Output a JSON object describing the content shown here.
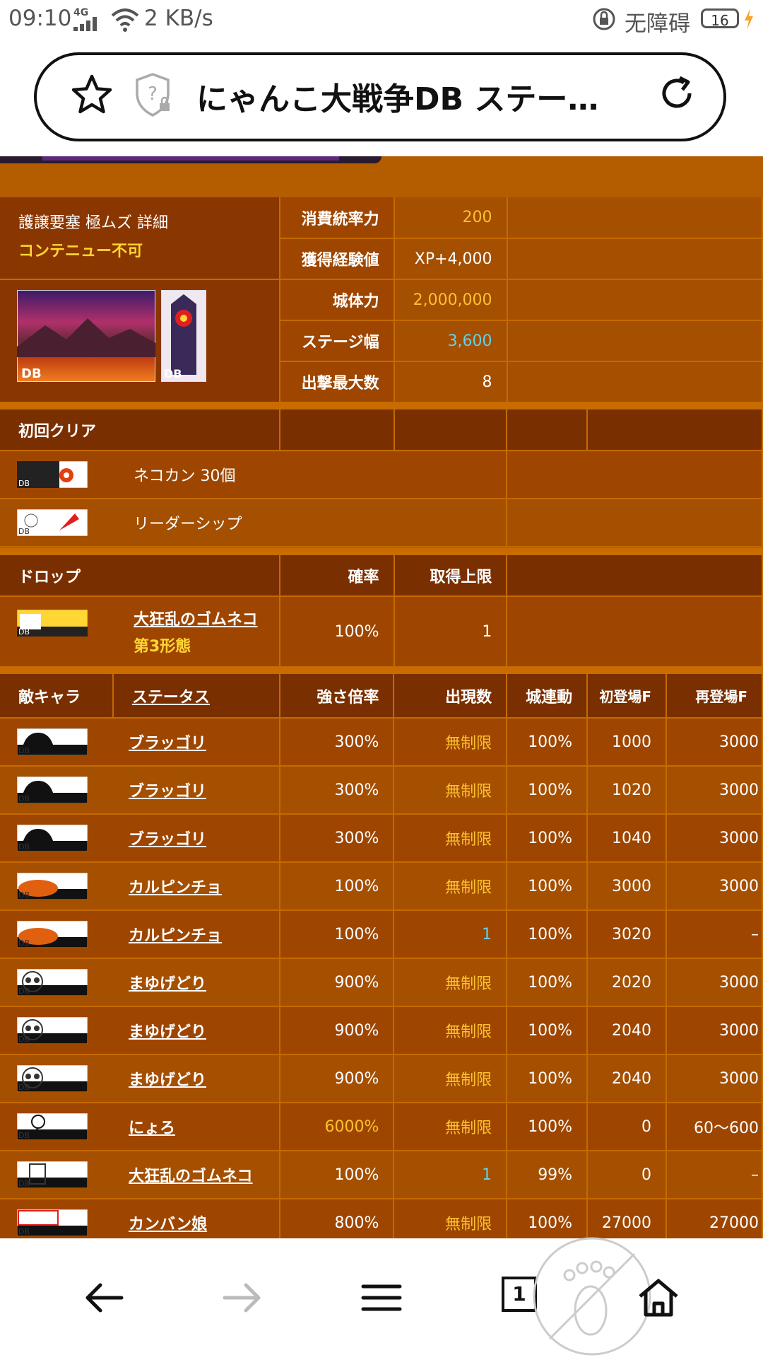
{
  "status_bar": {
    "time": "09:10",
    "network": "4G",
    "speed": "2 KB/s",
    "accessibility": "无障碍",
    "battery": "16"
  },
  "browser": {
    "page_title": "にゃんこ大戦争DB ステー…"
  },
  "stage": {
    "name": "護譲要塞 極ムズ 詳細",
    "note": "コンテニュー不可",
    "thumb_badge": "DB",
    "stats": [
      {
        "label": "消費統率力",
        "value": "200",
        "color": "gold"
      },
      {
        "label": "獲得経験値",
        "value": "XP+4,000",
        "color": "white"
      },
      {
        "label": "城体力",
        "value": "2,000,000",
        "color": "gold"
      },
      {
        "label": "ステージ幅",
        "value": "3,600",
        "color": "cyan"
      },
      {
        "label": "出撃最大数",
        "value": "8",
        "color": "white"
      }
    ]
  },
  "first_clear": {
    "header": "初回クリア",
    "items": [
      {
        "name": "ネコカン 30個"
      },
      {
        "name": "リーダーシップ"
      }
    ]
  },
  "drop": {
    "headers": [
      "ドロップ",
      "確率",
      "取得上限"
    ],
    "items": [
      {
        "name": "大狂乱のゴムネコ",
        "sub": "第3形態",
        "rate": "100%",
        "limit": "1"
      }
    ]
  },
  "enemies": {
    "headers": [
      "敵キャラ",
      "ステータス",
      "強さ倍率",
      "出現数",
      "城連動",
      "初登場F",
      "再登場F"
    ],
    "rows": [
      {
        "name": "ブラッゴリ",
        "mult": "300%",
        "count": "無制限",
        "castle": "100%",
        "first": "1000",
        "re": "3000"
      },
      {
        "name": "ブラッゴリ",
        "mult": "300%",
        "count": "無制限",
        "castle": "100%",
        "first": "1020",
        "re": "3000"
      },
      {
        "name": "ブラッゴリ",
        "mult": "300%",
        "count": "無制限",
        "castle": "100%",
        "first": "1040",
        "re": "3000"
      },
      {
        "name": "カルピンチョ",
        "mult": "100%",
        "count": "無制限",
        "castle": "100%",
        "first": "3000",
        "re": "3000"
      },
      {
        "name": "カルピンチョ",
        "mult": "100%",
        "count": "1",
        "castle": "100%",
        "first": "3020",
        "re": "–"
      },
      {
        "name": "まゆげどり",
        "mult": "900%",
        "count": "無制限",
        "castle": "100%",
        "first": "2020",
        "re": "3000"
      },
      {
        "name": "まゆげどり",
        "mult": "900%",
        "count": "無制限",
        "castle": "100%",
        "first": "2040",
        "re": "3000"
      },
      {
        "name": "まゆげどり",
        "mult": "900%",
        "count": "無制限",
        "castle": "100%",
        "first": "2040",
        "re": "3000"
      },
      {
        "name": "にょろ",
        "mult": "6000%",
        "count": "無制限",
        "castle": "100%",
        "first": "0",
        "re": "60～600"
      },
      {
        "name": "大狂乱のゴムネコ",
        "mult": "100%",
        "count": "1",
        "castle": "99%",
        "first": "0",
        "re": "–"
      },
      {
        "name": "カンバン娘",
        "mult": "800%",
        "count": "無制限",
        "castle": "100%",
        "first": "27000",
        "re": "27000"
      }
    ]
  },
  "nav": {
    "tab_count": "1"
  }
}
